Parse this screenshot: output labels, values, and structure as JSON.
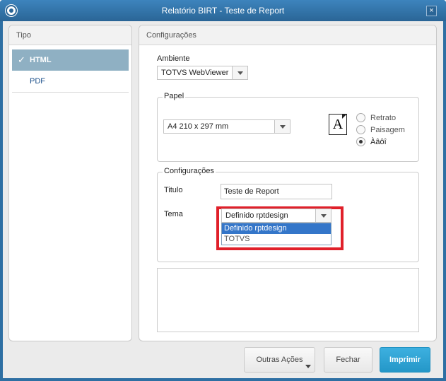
{
  "window": {
    "title": "Relatório BIRT - Teste de Report",
    "close_symbol": "×"
  },
  "left_panel": {
    "header": "Tipo",
    "items": [
      {
        "label": "HTML",
        "selected": true
      },
      {
        "label": "PDF",
        "selected": false
      }
    ]
  },
  "right_panel": {
    "header": "Configurações",
    "ambiente": {
      "label": "Ambiente",
      "value": "TOTVS WebViewer"
    },
    "papel": {
      "title": "Papel",
      "size_value": "A4 210 x 297 mm",
      "page_icon_letter": "A",
      "orientation_options": [
        "Retrato",
        "Paisagem",
        "Àâôî"
      ],
      "orientation_selected": "Àâôî"
    },
    "configuracoes": {
      "title": "Configurações",
      "titulo_label": "Titulo",
      "titulo_value": "Teste de Report",
      "tema_label": "Tema",
      "tema_value": "Definido rptdesign",
      "tema_options": [
        "Definido rptdesign",
        "TOTVS"
      ],
      "tema_highlighted": "Definido rptdesign"
    }
  },
  "footer": {
    "outras_acoes": "Outras Ações",
    "fechar": "Fechar",
    "imprimir": "Imprimir"
  },
  "colors": {
    "titlebar": "#2a6596",
    "selected_nav": "#8fb0c3",
    "highlight_border": "#e0202a",
    "primary_button": "#2497c8"
  }
}
